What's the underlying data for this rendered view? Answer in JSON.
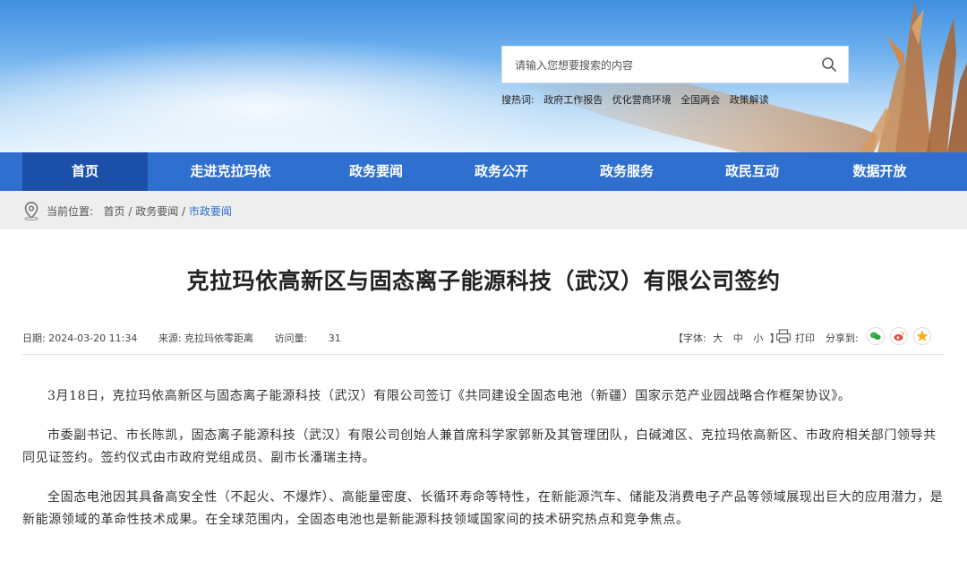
{
  "search": {
    "placeholder": "请输入您想要搜索的内容",
    "hot_label": "搜热词:",
    "hot_words": [
      "政府工作报告",
      "优化营商环境",
      "全国两会",
      "政策解读"
    ]
  },
  "nav": {
    "items": [
      "首页",
      "走进克拉玛依",
      "政务要闻",
      "政务公开",
      "政务服务",
      "政民互动",
      "数据开放"
    ],
    "active": "首页"
  },
  "breadcrumb": {
    "label": "当前位置:",
    "home": "首页",
    "section": "政务要闻",
    "current": "市政要闻",
    "sep": " / "
  },
  "article": {
    "title": "克拉玛依高新区与固态离子能源科技（武汉）有限公司签约",
    "date": "日期:  2024-03-20 11:34",
    "source": "来源:  克拉玛依零距离",
    "visits_label": "访问量:",
    "visits": "31",
    "paragraphs": [
      "3月18日，克拉玛依高新区与固态离子能源科技（武汉）有限公司签订《共同建设全固态电池（新疆）国家示范产业园战略合作框架协议》。",
      "市委副书记、市长陈凯，固态离子能源科技（武汉）有限公司创始人兼首席科学家郭新及其管理团队，白碱滩区、克拉玛依高新区、市政府相关部门领导共同见证签约。签约仪式由市政府党组成员、副市长潘瑞主持。",
      "全固态电池因其具备高安全性（不起火、不爆炸）、高能量密度、长循环寿命等特性，在新能源汽车、储能及消费电子产品等领域展现出巨大的应用潜力，是新能源领域的革命性技术成果。在全球范围内，全固态电池也是新能源科技领域国家间的技术研究热点和竞争焦点。"
    ]
  },
  "tools": {
    "font_label": "【字体:",
    "font_large": "大",
    "font_mid": "中",
    "font_small": "小",
    "font_close": "】",
    "print": "打印",
    "share": "分享到:",
    "share_icons": [
      "wechat-icon",
      "weibo-icon",
      "qzone-icon"
    ]
  },
  "colors": {
    "nav_bg": "#2f6fd0",
    "nav_active": "#1c4fa8",
    "crumb_bg": "#eeeeee",
    "link_blue": "#2f6fd0"
  }
}
